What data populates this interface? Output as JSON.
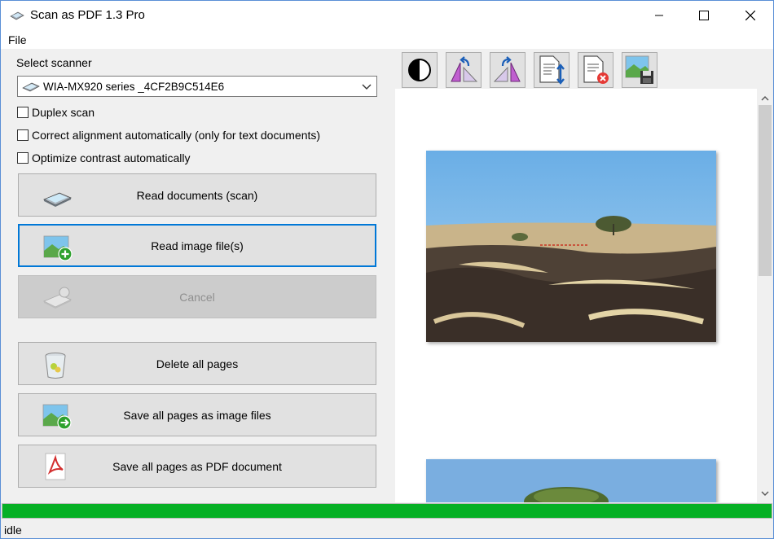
{
  "window": {
    "title": "Scan as PDF 1.3 Pro",
    "controls": {
      "minimize_icon": "minimize-icon",
      "maximize_icon": "maximize-icon",
      "close_icon": "close-icon"
    }
  },
  "menu": {
    "file": "File"
  },
  "scanner": {
    "label": "Select scanner",
    "selected": "WIA-MX920 series _4CF2B9C514E6"
  },
  "options": {
    "duplex": {
      "label": "Duplex scan",
      "checked": false
    },
    "alignment": {
      "label": "Correct alignment automatically (only for text documents)",
      "checked": false
    },
    "contrast": {
      "label": "Optimize contrast automatically",
      "checked": false
    }
  },
  "buttons": {
    "read_documents": "Read documents (scan)",
    "read_images": "Read image file(s)",
    "cancel": "Cancel",
    "delete_all": "Delete all pages",
    "save_images": "Save all pages as image files",
    "save_pdf": "Save all pages as PDF document"
  },
  "toolbar": {
    "tools": [
      "contrast-icon",
      "rotate-left-icon",
      "rotate-right-icon",
      "move-page-icon",
      "delete-page-icon",
      "save-image-icon"
    ]
  },
  "progress": {
    "value": 1.0,
    "color": "#06b025"
  },
  "status": {
    "text": "idle"
  },
  "colors": {
    "accent": "#0078d7",
    "progress": "#06b025"
  }
}
